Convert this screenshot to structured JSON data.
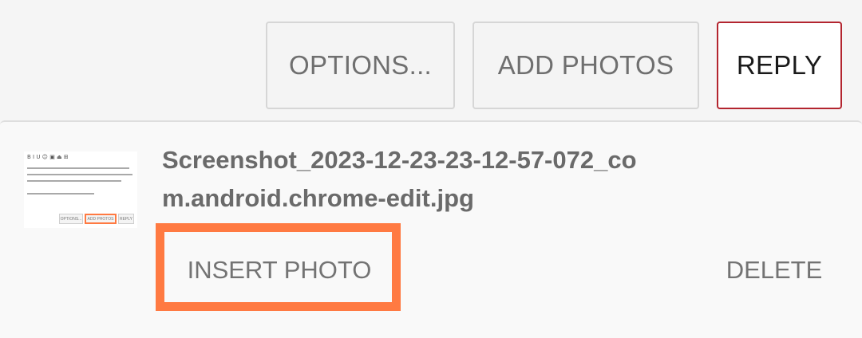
{
  "toolbar": {
    "options_label": "OPTIONS...",
    "add_photos_label": "ADD PHOTOS",
    "reply_label": "REPLY"
  },
  "attachment": {
    "filename": "Screenshot_2023-12-23-23-12-57-072_com.android.chrome-edit.jpg",
    "insert_label": "INSERT PHOTO",
    "delete_label": "DELETE",
    "thumbnail": {
      "toolbar_glyphs": "B  I  U  ☺ ▣ ⏏ ⊞",
      "options_label": "OPTIONS...",
      "add_photos_label": "ADD PHOTOS",
      "reply_label": "REPLY"
    }
  },
  "colors": {
    "reply_border": "#b3252f",
    "highlight": "#ff7a42",
    "text_gray": "#6f6f6f"
  }
}
